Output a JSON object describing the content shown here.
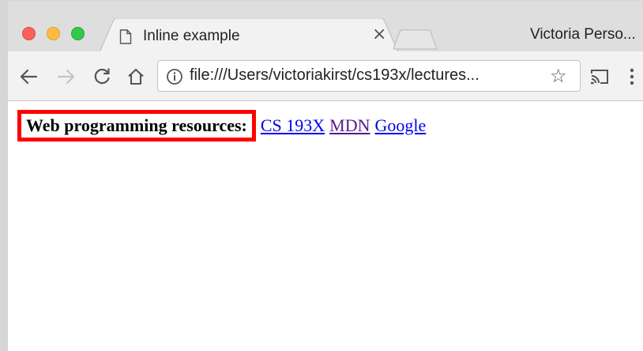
{
  "browser": {
    "tab": {
      "title": "Inline example"
    },
    "profile_name": "Victoria Perso...",
    "address_bar": {
      "url": "file:///Users/victoriakirst/cs193x/lectures..."
    }
  },
  "icons": {
    "back": "arrow-left-icon",
    "forward": "arrow-right-icon",
    "reload": "reload-icon",
    "home": "home-icon",
    "info": "info-icon",
    "bookmark": "star-icon",
    "cast": "cast-icon",
    "menu": "more-vert-icon",
    "close_tab": "close-icon",
    "page": "document-icon"
  },
  "page": {
    "heading": "Web programming resources:",
    "links": [
      {
        "label": "CS 193X",
        "visited": false
      },
      {
        "label": "MDN",
        "visited": true
      },
      {
        "label": "Google",
        "visited": false
      }
    ]
  },
  "colors": {
    "highlight_border": "#ff0000",
    "link": "#0000ee",
    "visited_link": "#551a8b"
  }
}
